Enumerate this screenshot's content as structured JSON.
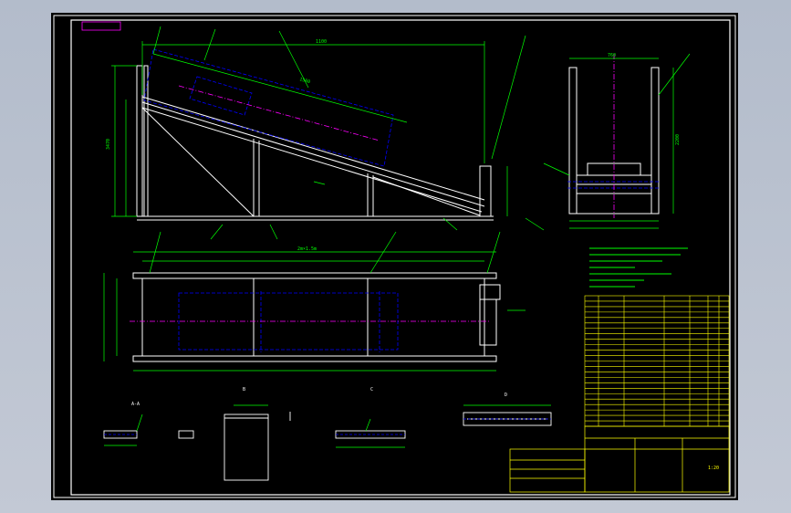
{
  "window": {
    "title": ""
  },
  "drawing": {
    "stamp_label": "",
    "notes_header": "",
    "dims": {
      "top_span": "1100",
      "belt_len": "1500",
      "base_len": "2m×1.5m",
      "height_total": "3470",
      "width_side": "760",
      "height_side": "2200"
    },
    "section_labels": [
      "A-A",
      "B",
      "C",
      "D"
    ],
    "title_block": {
      "title_line": "",
      "sub_line": "",
      "drawing_no": "",
      "scale": "1:20"
    },
    "colors": {
      "paper": "#000000",
      "frame": "#ffffff",
      "outline": "#ffffff",
      "dimension": "#00ff00",
      "hidden": "#0000ff",
      "center": "#ff00ff",
      "table": "#ffff00"
    }
  }
}
